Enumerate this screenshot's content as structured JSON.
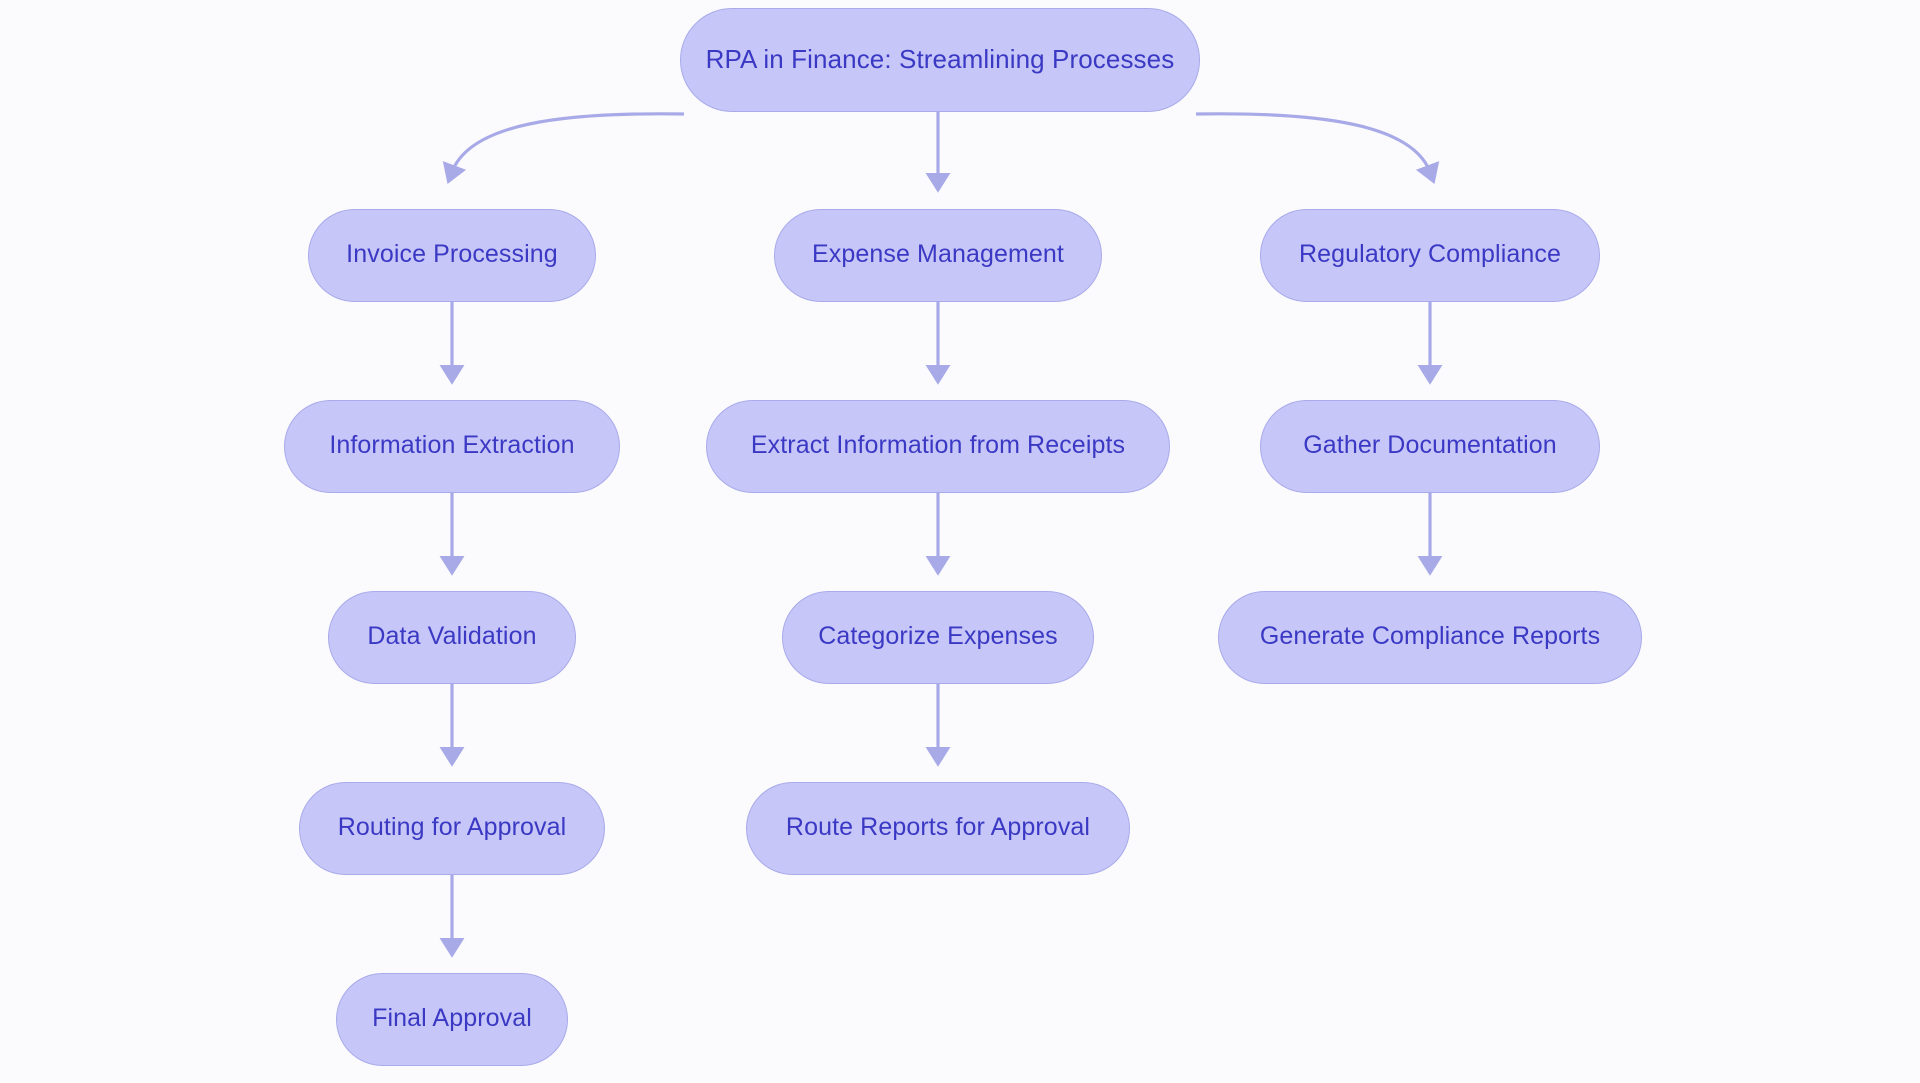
{
  "diagram": {
    "title": "RPA in Finance: Streamlining Processes",
    "type": "flowchart",
    "background_color": "#fbfbfe",
    "node_fill_color": "#c6c7f8",
    "node_border_color": "#a9aaea",
    "node_text_color": "#3b39c4",
    "edge_color": "#a8aae8",
    "root": {
      "id": "root",
      "label": "RPA in Finance: Streamlining Processes"
    },
    "branches": [
      {
        "id": "branch-invoice",
        "name": "invoice-processing-branch",
        "steps": [
          {
            "id": "invoice-processing",
            "label": "Invoice Processing"
          },
          {
            "id": "information-extraction",
            "label": "Information Extraction"
          },
          {
            "id": "data-validation",
            "label": "Data Validation"
          },
          {
            "id": "routing-for-approval",
            "label": "Routing for Approval"
          },
          {
            "id": "final-approval",
            "label": "Final Approval"
          }
        ]
      },
      {
        "id": "branch-expense",
        "name": "expense-management-branch",
        "steps": [
          {
            "id": "expense-management",
            "label": "Expense Management"
          },
          {
            "id": "extract-information-from-receipts",
            "label": "Extract Information from Receipts"
          },
          {
            "id": "categorize-expenses",
            "label": "Categorize Expenses"
          },
          {
            "id": "route-reports-for-approval",
            "label": "Route Reports for Approval"
          }
        ]
      },
      {
        "id": "branch-compliance",
        "name": "regulatory-compliance-branch",
        "steps": [
          {
            "id": "regulatory-compliance",
            "label": "Regulatory Compliance"
          },
          {
            "id": "gather-documentation",
            "label": "Gather Documentation"
          },
          {
            "id": "generate-compliance-reports",
            "label": "Generate Compliance Reports"
          }
        ]
      }
    ],
    "edges": [
      {
        "from": "root",
        "to": "invoice-processing",
        "style": "curved"
      },
      {
        "from": "root",
        "to": "expense-management",
        "style": "straight"
      },
      {
        "from": "root",
        "to": "regulatory-compliance",
        "style": "curved"
      },
      {
        "from": "invoice-processing",
        "to": "information-extraction",
        "style": "straight"
      },
      {
        "from": "information-extraction",
        "to": "data-validation",
        "style": "straight"
      },
      {
        "from": "data-validation",
        "to": "routing-for-approval",
        "style": "straight"
      },
      {
        "from": "routing-for-approval",
        "to": "final-approval",
        "style": "straight"
      },
      {
        "from": "expense-management",
        "to": "extract-information-from-receipts",
        "style": "straight"
      },
      {
        "from": "extract-information-from-receipts",
        "to": "categorize-expenses",
        "style": "straight"
      },
      {
        "from": "categorize-expenses",
        "to": "route-reports-for-approval",
        "style": "straight"
      },
      {
        "from": "regulatory-compliance",
        "to": "gather-documentation",
        "style": "straight"
      },
      {
        "from": "gather-documentation",
        "to": "generate-compliance-reports",
        "style": "straight"
      }
    ]
  }
}
